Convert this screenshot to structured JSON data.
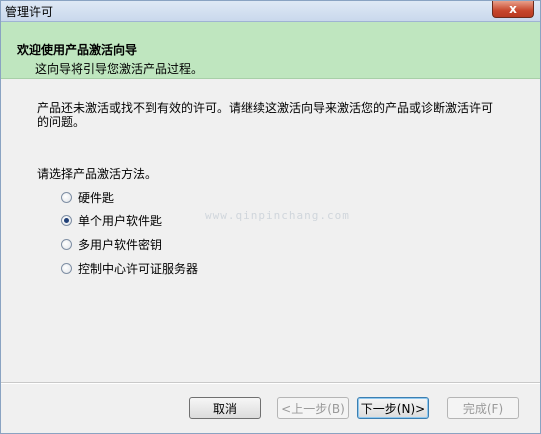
{
  "window": {
    "title": "管理许可",
    "close_glyph": "x"
  },
  "header": {
    "title": "欢迎使用产品激活向导",
    "subtitle": "这向导将引导您激活产品过程。"
  },
  "body": {
    "description": "产品还未激活或找不到有效的许可。请继续这激活向导来激活您的产品或诊断激活许可的问题。",
    "prompt": "请选择产品激活方法。"
  },
  "options": [
    {
      "label": "硬件匙",
      "checked": false
    },
    {
      "label": "单个用户软件匙",
      "checked": true
    },
    {
      "label": "多用户软件密钥",
      "checked": false
    },
    {
      "label": "控制中心许可证服务器",
      "checked": false
    }
  ],
  "watermark": "www.qinpinchang.com",
  "buttons": {
    "cancel": "取消",
    "back": "<上一步(B)",
    "next": "下一步(N)>",
    "finish": "完成(F)"
  }
}
